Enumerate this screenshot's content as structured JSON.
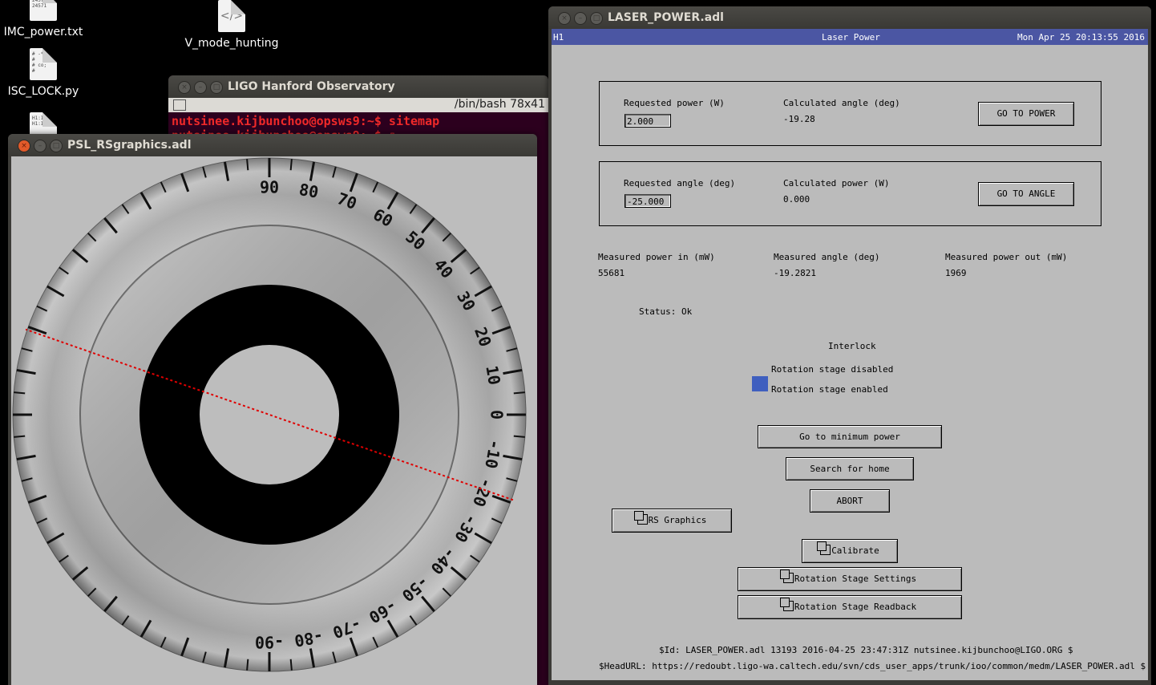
{
  "desktop": {
    "icons": [
      {
        "label": "IMC_power.txt"
      },
      {
        "label": "V_mode_hunting"
      },
      {
        "label": "ISC_LOCK.py"
      }
    ]
  },
  "terminal": {
    "title": "LIGO Hanford Observatory",
    "size_label": "/bin/bash 78x41",
    "line1": "nutsinee.kijbunchoo@opsws9:~$ sitemap",
    "line2": "nutsinee.kijbunchoo@opsws9:~$ ▯"
  },
  "rs_window": {
    "title": "PSL_RSgraphics.adl",
    "dial_labels": [
      "90",
      "80",
      "70",
      "60",
      "50",
      "40",
      "30",
      "20",
      "10",
      "0",
      "-10",
      "-20",
      "-30",
      "-40",
      "-50",
      "-60",
      "-70",
      "-80",
      "-90"
    ],
    "needle_angle_deg": -19.28
  },
  "laser_window": {
    "title": "LASER_POWER.adl",
    "header": {
      "left": "H1",
      "center": "Laser Power",
      "right": "Mon Apr 25 20:13:55 2016"
    },
    "power_panel": {
      "req_label": "Requested power (W)",
      "req_value": "2.000",
      "calc_label": "Calculated angle (deg)",
      "calc_value": "-19.28",
      "button": "GO TO POWER"
    },
    "angle_panel": {
      "req_label": "Requested angle (deg)",
      "req_value": "-25.000",
      "calc_label": "Calculated power (W)",
      "calc_value": "0.000",
      "button": "GO TO ANGLE"
    },
    "measured": {
      "pin_label": "Measured power in (mW)",
      "pin_value": "55681",
      "angle_label": "Measured angle (deg)",
      "angle_value": "-19.2821",
      "pout_label": "Measured power out (mW)",
      "pout_value": "1969"
    },
    "status": "Status: Ok",
    "interlock": {
      "title": "Interlock",
      "disabled": "Rotation stage disabled",
      "enabled": "Rotation stage enabled",
      "indicator_color": "#3f5fbf"
    },
    "buttons": {
      "min_power": "Go to minimum power",
      "search_home": "Search for home",
      "abort": "ABORT",
      "rs_graphics": "RS Graphics",
      "calibrate": "Calibrate",
      "rs_settings": "Rotation Stage Settings",
      "rs_readback": "Rotation Stage Readback"
    },
    "footer": {
      "id": "$Id: LASER_POWER.adl 13193 2016-04-25 23:47:31Z nutsinee.kijbunchoo@LIGO.ORG $",
      "url": "$HeadURL: https://redoubt.ligo-wa.caltech.edu/svn/cds_user_apps/trunk/ioo/common/medm/LASER_POWER.adl $"
    }
  }
}
